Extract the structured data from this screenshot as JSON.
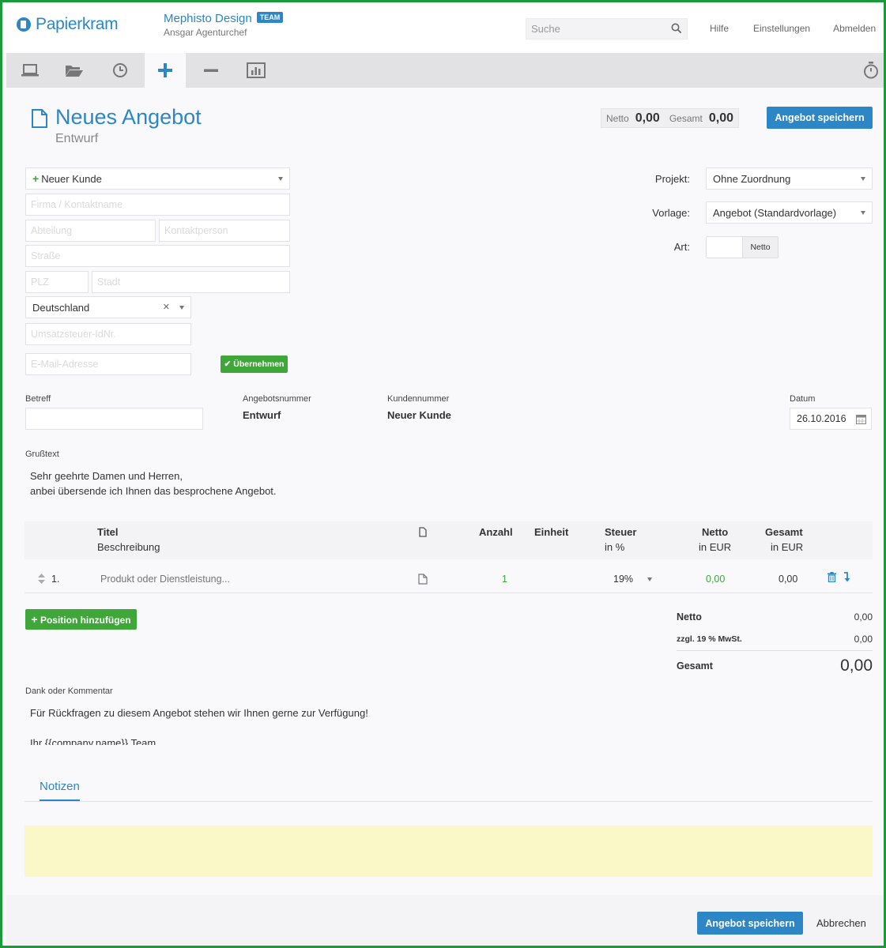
{
  "brand": {
    "logo_prefix": "Papier",
    "logo_suffix": "kram"
  },
  "account": {
    "company": "Mephisto Design",
    "badge": "TEAM",
    "user": "Ansgar Agenturchef"
  },
  "search": {
    "placeholder": "Suche"
  },
  "toplinks": {
    "help": "Hilfe",
    "settings": "Einstellungen",
    "logout": "Abmelden"
  },
  "tabs": [
    {
      "icon": "laptop-icon"
    },
    {
      "icon": "folder-open-icon"
    },
    {
      "icon": "clock-icon"
    },
    {
      "icon": "plus-icon",
      "active": true
    },
    {
      "icon": "minus-icon"
    },
    {
      "icon": "bar-chart-icon"
    },
    {
      "icon": "stopwatch-icon"
    }
  ],
  "page": {
    "title": "Neues Angebot",
    "subtitle": "Entwurf"
  },
  "totals": {
    "netto_label": "Netto",
    "netto_value": "0,00",
    "gesamt_label": "Gesamt",
    "gesamt_value": "0,00"
  },
  "actions": {
    "save": "Angebot speichern",
    "cancel": "Abbrechen"
  },
  "customer": {
    "select_label": "Neuer Kunde",
    "company_placeholder": "Firma / Kontaktname",
    "department_placeholder": "Abteilung",
    "contact_placeholder": "Kontaktperson",
    "street_placeholder": "Straße",
    "zip_placeholder": "PLZ",
    "city_placeholder": "Stadt",
    "country": "Deutschland",
    "vat_placeholder": "Umsatzsteuer-IdNr.",
    "email_placeholder": "E-Mail-Adresse",
    "apply_button": "Übernehmen"
  },
  "meta": {
    "project_label": "Projekt:",
    "project_value": "Ohne Zuordnung",
    "template_label": "Vorlage:",
    "template_value": "Angebot (Standardvorlage)",
    "type_label": "Art:",
    "type_value": "Netto"
  },
  "offer": {
    "subject_label": "Betreff",
    "number_label": "Angebotsnummer",
    "number_value": "Entwurf",
    "customer_no_label": "Kundennummer",
    "customer_no_value": "Neuer Kunde",
    "date_label": "Datum",
    "date_value": "26.10.2016"
  },
  "greeting": {
    "label": "Grußtext",
    "line1": "Sehr geehrte Damen und Herren,",
    "line2": "anbei übersende ich Ihnen das besprochene Angebot."
  },
  "items": {
    "headers": {
      "title": "Titel",
      "description": "Beschreibung",
      "quantity": "Anzahl",
      "unit": "Einheit",
      "tax": "Steuer",
      "tax_unit": "in %",
      "net": "Netto",
      "net_unit": "in EUR",
      "total": "Gesamt",
      "total_unit": "in EUR"
    },
    "rows": [
      {
        "index": "1.",
        "placeholder": "Produkt oder Dienstleistung...",
        "quantity": "1",
        "tax": "19%",
        "net": "0,00",
        "total": "0,00"
      }
    ],
    "add_button": "Position hinzufügen"
  },
  "summary": {
    "net_label": "Netto",
    "net_value": "0,00",
    "vat_label": "zzgl. 19 % MwSt.",
    "vat_value": "0,00",
    "total_label": "Gesamt",
    "total_value": "0,00"
  },
  "closing": {
    "label": "Dank oder Kommentar",
    "line1": "Für Rückfragen zu diesem Angebot stehen wir Ihnen gerne zur Verfügung!",
    "line2": "Ihr {{company.name}} Team"
  },
  "notes": {
    "tab": "Notizen"
  },
  "colors": {
    "accent": "#2d86c5",
    "success": "#3fa63a",
    "frame": "#1a9a3a",
    "notes_bg": "#fbf8c8"
  }
}
